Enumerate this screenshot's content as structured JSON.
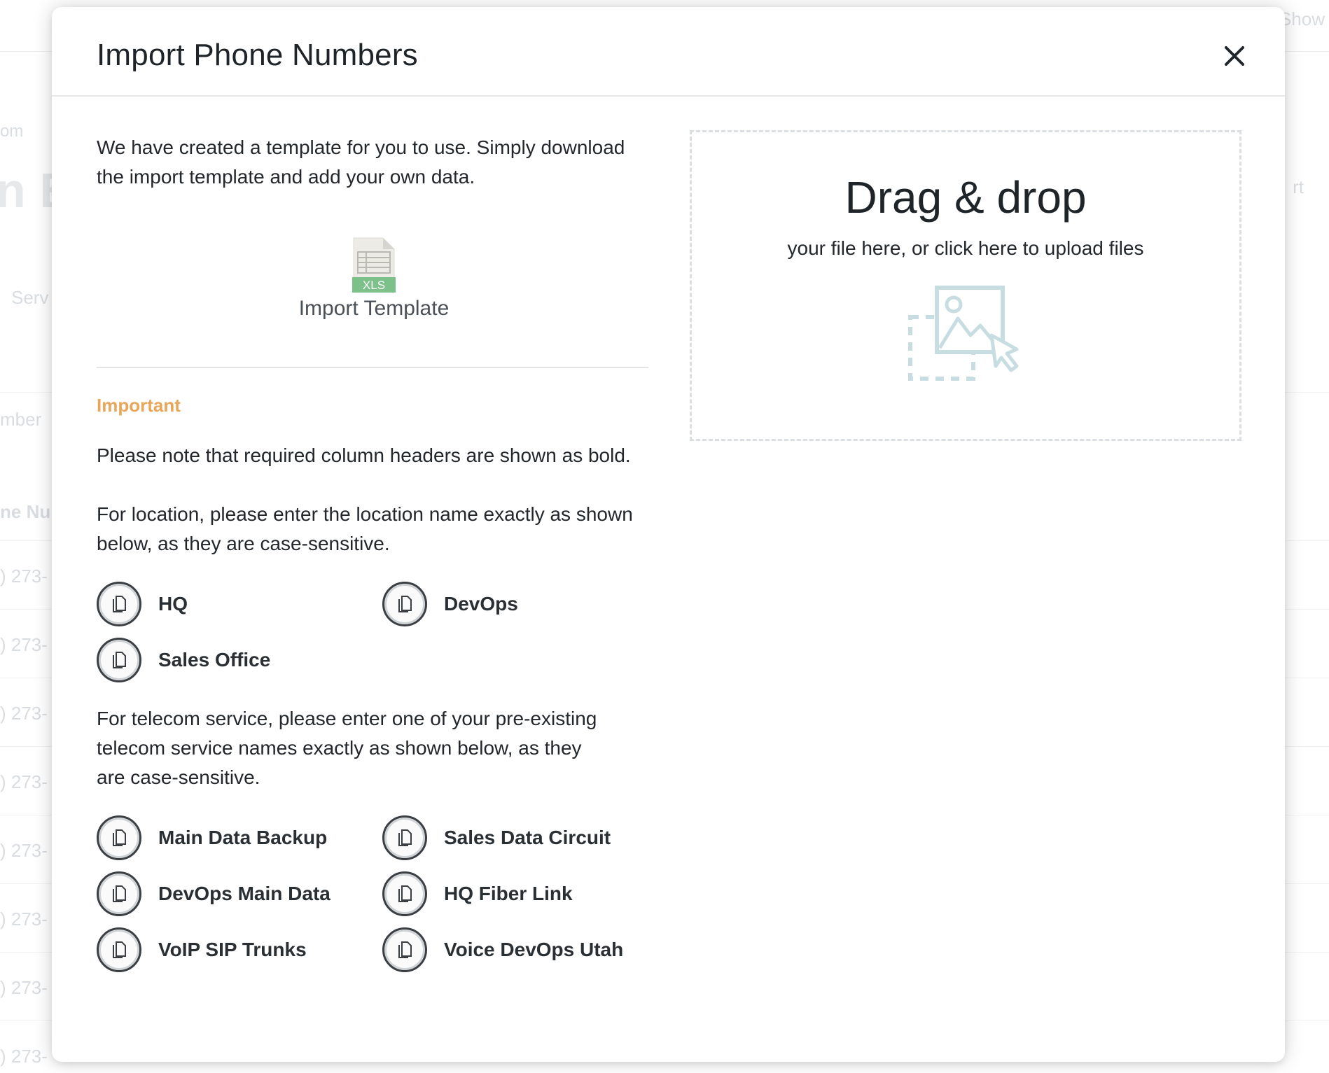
{
  "background": {
    "top_right": "Show",
    "breadcrumb": "om",
    "heading": "n B",
    "right_link": "rt",
    "services_label": "Serv",
    "numbers_label": "mber",
    "column_label": "ne Nu",
    "row_prefix": ") 273-"
  },
  "modal": {
    "title": "Import Phone Numbers",
    "close_label": "×"
  },
  "intro": {
    "text": "We have created a template for you to use. Simply download the import template and add your own data."
  },
  "template": {
    "badge": "XLS",
    "label": "Import Template"
  },
  "important": {
    "heading": "Important",
    "bold_note": "Please note that required column headers are shown as bold.",
    "location_note": "For location, please enter the location name exactly as shown below, as they are case-sensitive.",
    "telecom_note": "For telecom service, please enter one of your pre-existing telecom service names exactly as shown below, as they are case-sensitive."
  },
  "locations": [
    "HQ",
    "DevOps",
    "Sales Office"
  ],
  "telecom_services": [
    "Main Data Backup",
    "Sales Data Circuit",
    "DevOps Main Data",
    "HQ Fiber Link",
    "VoIP SIP Trunks",
    "Voice DevOps Utah"
  ],
  "dropzone": {
    "title": "Drag & drop",
    "subtitle": "your file here, or click here to upload files"
  },
  "colors": {
    "important": "#e9a65a",
    "xls_green": "#7cc08a",
    "dropzone_icon": "#c7dde2"
  }
}
